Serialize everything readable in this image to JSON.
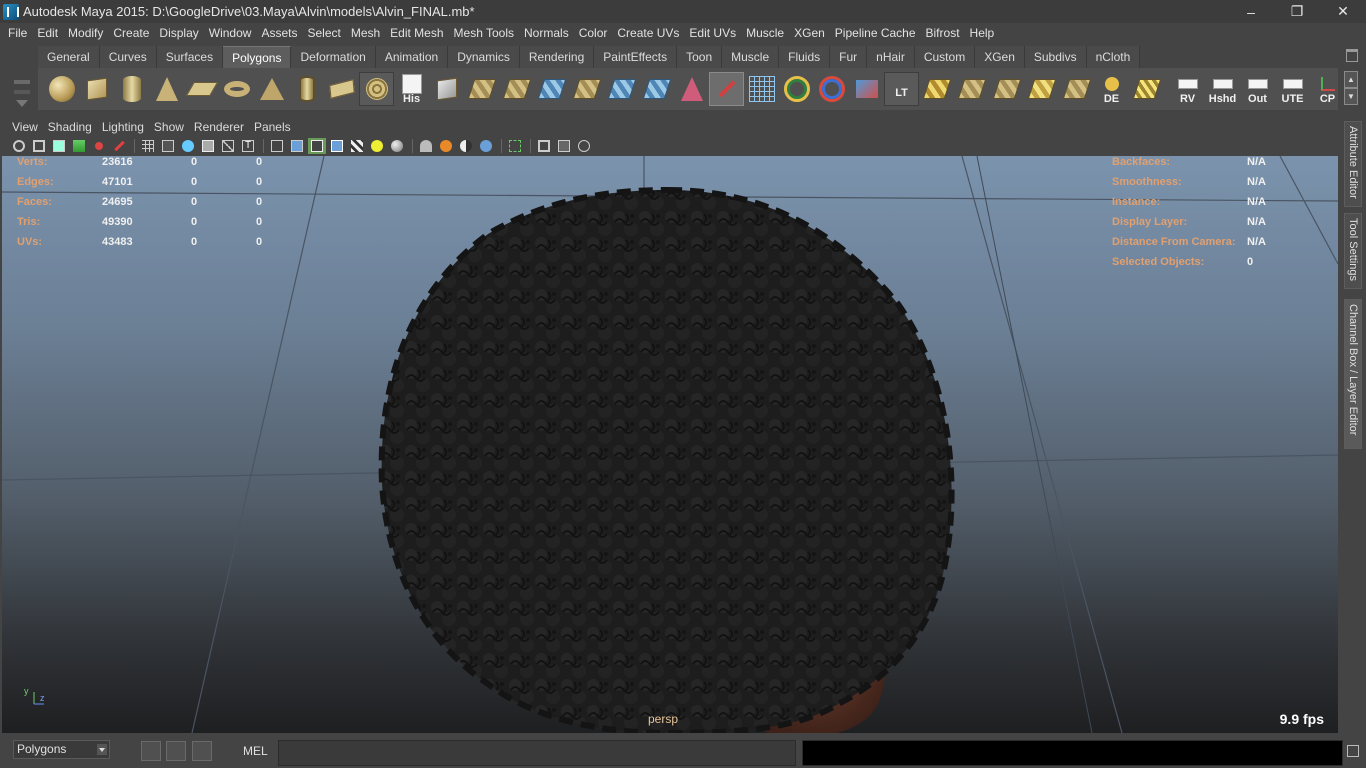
{
  "window": {
    "title": "Autodesk Maya 2015: D:\\GoogleDrive\\03.Maya\\Alvin\\models\\Alvin_FINAL.mb*"
  },
  "menubar": [
    "File",
    "Edit",
    "Modify",
    "Create",
    "Display",
    "Window",
    "Assets",
    "Select",
    "Mesh",
    "Edit Mesh",
    "Mesh Tools",
    "Normals",
    "Color",
    "Create UVs",
    "Edit UVs",
    "Muscle",
    "XGen",
    "Pipeline Cache",
    "Bifrost",
    "Help"
  ],
  "shelf": {
    "tabs": [
      "General",
      "Curves",
      "Surfaces",
      "Polygons",
      "Deformation",
      "Animation",
      "Dynamics",
      "Rendering",
      "PaintEffects",
      "Toon",
      "Muscle",
      "Fluids",
      "Fur",
      "nHair",
      "Custom",
      "XGen",
      "Subdivs",
      "nCloth"
    ],
    "active_tab": "Polygons",
    "labels": {
      "his": "His",
      "lt": "LT",
      "de": "DE",
      "rv": "RV",
      "hshd": "Hshd",
      "out": "Out",
      "ute": "UTE",
      "cp": "CP"
    }
  },
  "panel_menu": [
    "View",
    "Shading",
    "Lighting",
    "Show",
    "Renderer",
    "Panels"
  ],
  "hud_left": {
    "rows": [
      {
        "label": "Verts:",
        "v1": "23616",
        "v2": "0",
        "v3": "0"
      },
      {
        "label": "Edges:",
        "v1": "47101",
        "v2": "0",
        "v3": "0"
      },
      {
        "label": "Faces:",
        "v1": "24695",
        "v2": "0",
        "v3": "0"
      },
      {
        "label": "Tris:",
        "v1": "49390",
        "v2": "0",
        "v3": "0"
      },
      {
        "label": "UVs:",
        "v1": "43483",
        "v2": "0",
        "v3": "0"
      }
    ]
  },
  "hud_right": {
    "rows": [
      {
        "label": "Backfaces:",
        "value": "N/A"
      },
      {
        "label": "Smoothness:",
        "value": "N/A"
      },
      {
        "label": "Instance:",
        "value": "N/A"
      },
      {
        "label": "Display Layer:",
        "value": "N/A"
      },
      {
        "label": "Distance From Camera:",
        "value": "N/A"
      },
      {
        "label": "Selected Objects:",
        "value": "0"
      }
    ]
  },
  "viewport": {
    "camera": "persp",
    "fps": "9.9 fps",
    "axis_y": "y",
    "axis_z": "z"
  },
  "right_tabs": [
    "Attribute Editor",
    "Tool Settings",
    "Channel Box / Layer Editor"
  ],
  "bottom": {
    "mode": "Polygons",
    "mel_label": "MEL"
  }
}
